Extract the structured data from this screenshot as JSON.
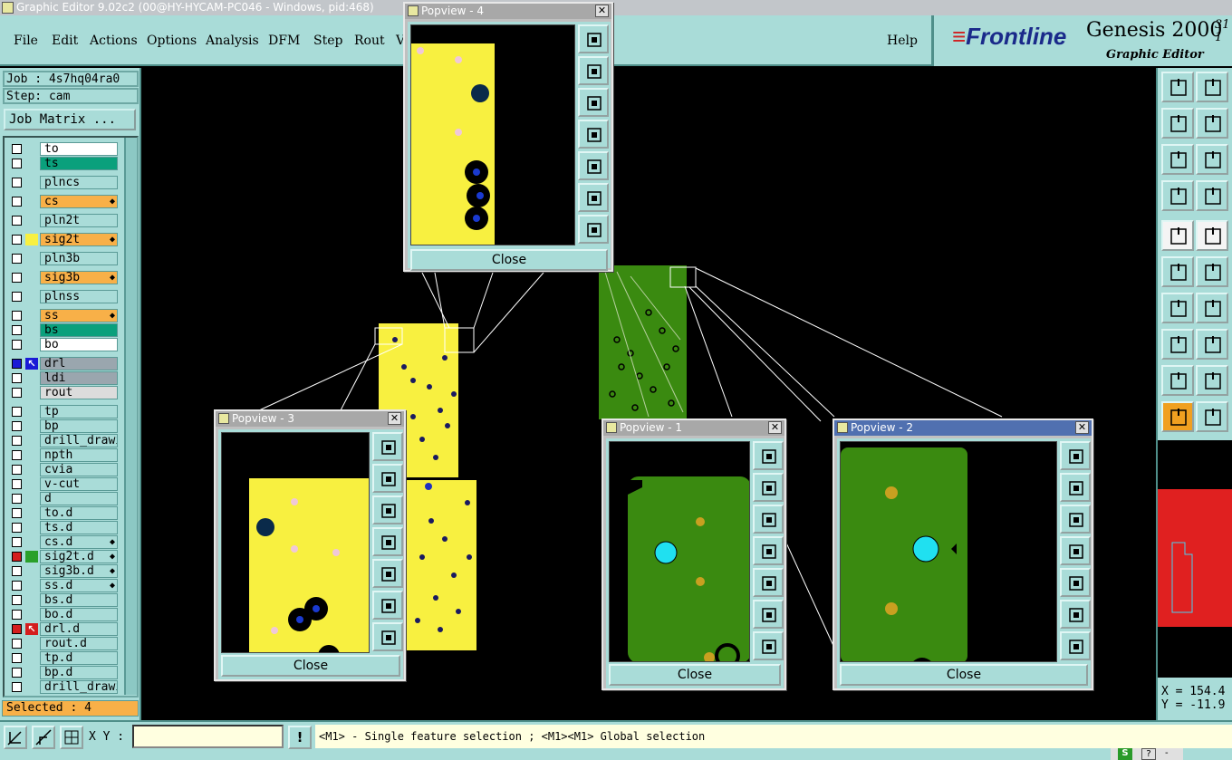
{
  "window": {
    "title": "Graphic Editor 9.02c2 (00@HY-HYCAM-PC046 - Windows, pid:468)"
  },
  "menu": {
    "items": [
      "File",
      "Edit",
      "Actions",
      "Options",
      "Analysis",
      "DFM",
      "Step",
      "Rout",
      "V"
    ],
    "help": "Help"
  },
  "brand": {
    "logo": "Frontline",
    "product": "Genesis 2000",
    "version_top": "31",
    "version_bottom": "1",
    "subtitle": "Graphic Editor"
  },
  "job": {
    "job_label": "Job : 4s7hq04ra0",
    "step_label": "Step: cam",
    "matrix_button": "Job Matrix ..."
  },
  "layers": [
    {
      "name": "to",
      "color": "white",
      "checkbox": "white"
    },
    {
      "name": "ts",
      "color": "teal",
      "checkbox": "white"
    },
    {
      "name": "plncs",
      "color": "",
      "checkbox": "white"
    },
    {
      "name": "cs",
      "color": "orange",
      "checkbox": "white",
      "flag": true
    },
    {
      "name": "pln2t",
      "color": "",
      "checkbox": "white"
    },
    {
      "name": "sig2t",
      "color": "orange",
      "checkbox": "white",
      "flag": true,
      "swatch": "#f8f040"
    },
    {
      "name": "pln3b",
      "color": "",
      "checkbox": "white"
    },
    {
      "name": "sig3b",
      "color": "orange",
      "checkbox": "white",
      "flag": true
    },
    {
      "name": "plnss",
      "color": "",
      "checkbox": "white"
    },
    {
      "name": "ss",
      "color": "orange",
      "checkbox": "white",
      "flag": true
    },
    {
      "name": "bs",
      "color": "teal",
      "checkbox": "white"
    },
    {
      "name": "bo",
      "color": "white",
      "checkbox": "white"
    },
    {
      "name": "drl",
      "color": "darkgrey",
      "checkbox": "blue",
      "arrow": true
    },
    {
      "name": "ldi",
      "color": "darkgrey",
      "checkbox": "white"
    },
    {
      "name": "rout",
      "color": "lightgrey",
      "checkbox": "white"
    },
    {
      "name": "tp",
      "color": "",
      "checkbox": "white"
    },
    {
      "name": "bp",
      "color": "",
      "checkbox": "white"
    },
    {
      "name": "drill_drawing",
      "color": "",
      "checkbox": "white"
    },
    {
      "name": "npth",
      "color": "",
      "checkbox": "white"
    },
    {
      "name": "cvia",
      "color": "",
      "checkbox": "white"
    },
    {
      "name": "v-cut",
      "color": "",
      "checkbox": "white"
    },
    {
      "name": "d",
      "color": "",
      "checkbox": "white"
    },
    {
      "name": "to.d",
      "color": "",
      "checkbox": "white"
    },
    {
      "name": "ts.d",
      "color": "",
      "checkbox": "white"
    },
    {
      "name": "cs.d",
      "color": "",
      "checkbox": "white",
      "flag": true
    },
    {
      "name": "sig2t.d",
      "color": "",
      "checkbox": "red",
      "flag": true,
      "swatch": "#2aa02a"
    },
    {
      "name": "sig3b.d",
      "color": "",
      "checkbox": "white",
      "flag": true
    },
    {
      "name": "ss.d",
      "color": "",
      "checkbox": "white",
      "flag": true
    },
    {
      "name": "bs.d",
      "color": "",
      "checkbox": "white"
    },
    {
      "name": "bo.d",
      "color": "",
      "checkbox": "white"
    },
    {
      "name": "drl.d",
      "color": "",
      "checkbox": "red",
      "arrow_red": true
    },
    {
      "name": "rout.d",
      "color": "",
      "checkbox": "white"
    },
    {
      "name": "tp.d",
      "color": "",
      "checkbox": "white"
    },
    {
      "name": "bp.d",
      "color": "",
      "checkbox": "white"
    },
    {
      "name": "drill_drawing",
      "color": "",
      "checkbox": "white"
    }
  ],
  "selected_label": "Selected : 4",
  "popviews": [
    {
      "title": "Popview - 4",
      "close": "Close"
    },
    {
      "title": "Popview - 3",
      "close": "Close"
    },
    {
      "title": "Popview - 1",
      "close": "Close"
    },
    {
      "title": "Popview - 2",
      "close": "Close"
    }
  ],
  "coords": {
    "x": "X = 154.4",
    "y": "Y = -11.9"
  },
  "bottom": {
    "xy_label": "X Y :",
    "bang": "!",
    "status": "<M1> - Single feature selection ; <M1><M1> Global selection"
  },
  "colors": {
    "panel": "#a9dcd8",
    "board_yellow": "#f8f040",
    "board_green": "#3a8a10",
    "highlight_orange": "#f8b048",
    "layer_teal": "#0aa07c"
  }
}
